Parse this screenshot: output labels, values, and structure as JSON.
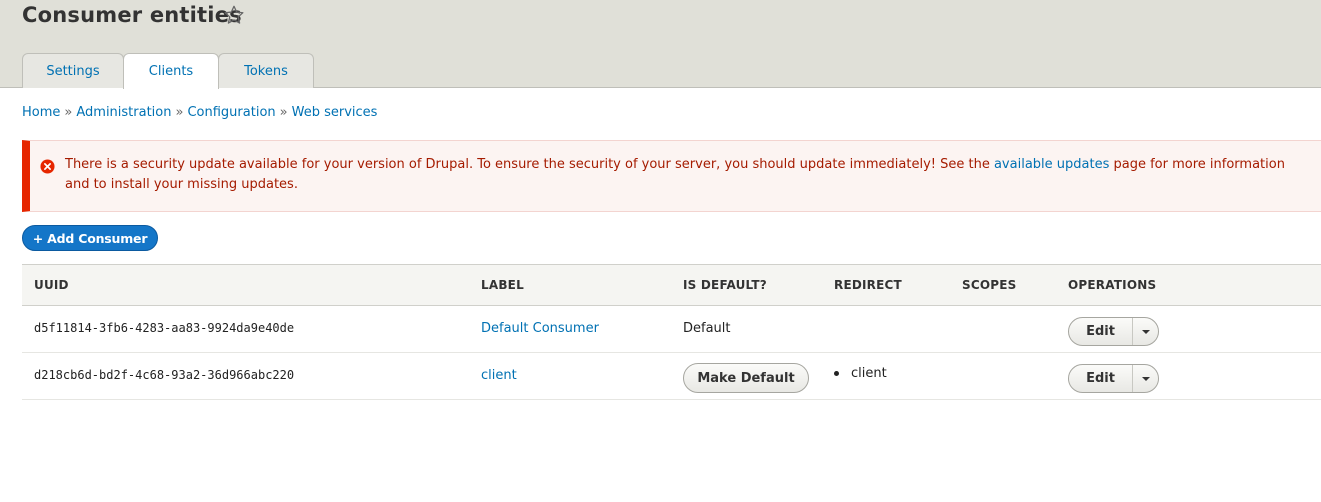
{
  "header": {
    "title": "Consumer entities",
    "tabs": [
      {
        "label": "Settings",
        "active": false
      },
      {
        "label": "Clients",
        "active": true
      },
      {
        "label": "Tokens",
        "active": false
      }
    ]
  },
  "breadcrumb": [
    {
      "label": "Home"
    },
    {
      "label": "Administration"
    },
    {
      "label": "Configuration"
    },
    {
      "label": "Web services"
    }
  ],
  "breadcrumb_separator": "»",
  "alert": {
    "text_before": "There is a security update available for your version of Drupal. To ensure the security of your server, you should update immediately! See the ",
    "link_text": "available updates",
    "text_after": " page for more information and to install your missing updates.",
    "color": "#e62600"
  },
  "actions": {
    "add_consumer_label": "+ Add Consumer"
  },
  "table": {
    "headers": [
      "UUID",
      "LABEL",
      "IS DEFAULT?",
      "REDIRECT",
      "SCOPES",
      "OPERATIONS"
    ],
    "rows": [
      {
        "uuid": "d5f11814-3fb6-4283-aa83-9924da9e40de",
        "label": "Default Consumer",
        "is_default": "Default",
        "redirect": "",
        "scopes": "",
        "operation": "Edit"
      },
      {
        "uuid": "d218cb6d-bd2f-4c68-93a2-36d966abc220",
        "label": "client",
        "make_default_label": "Make Default",
        "redirect": "client",
        "scopes": "",
        "operation": "Edit"
      }
    ]
  },
  "colors": {
    "link": "#0071b3",
    "primary_button": "#1476c8",
    "header_bg": "#e0e0d8"
  }
}
